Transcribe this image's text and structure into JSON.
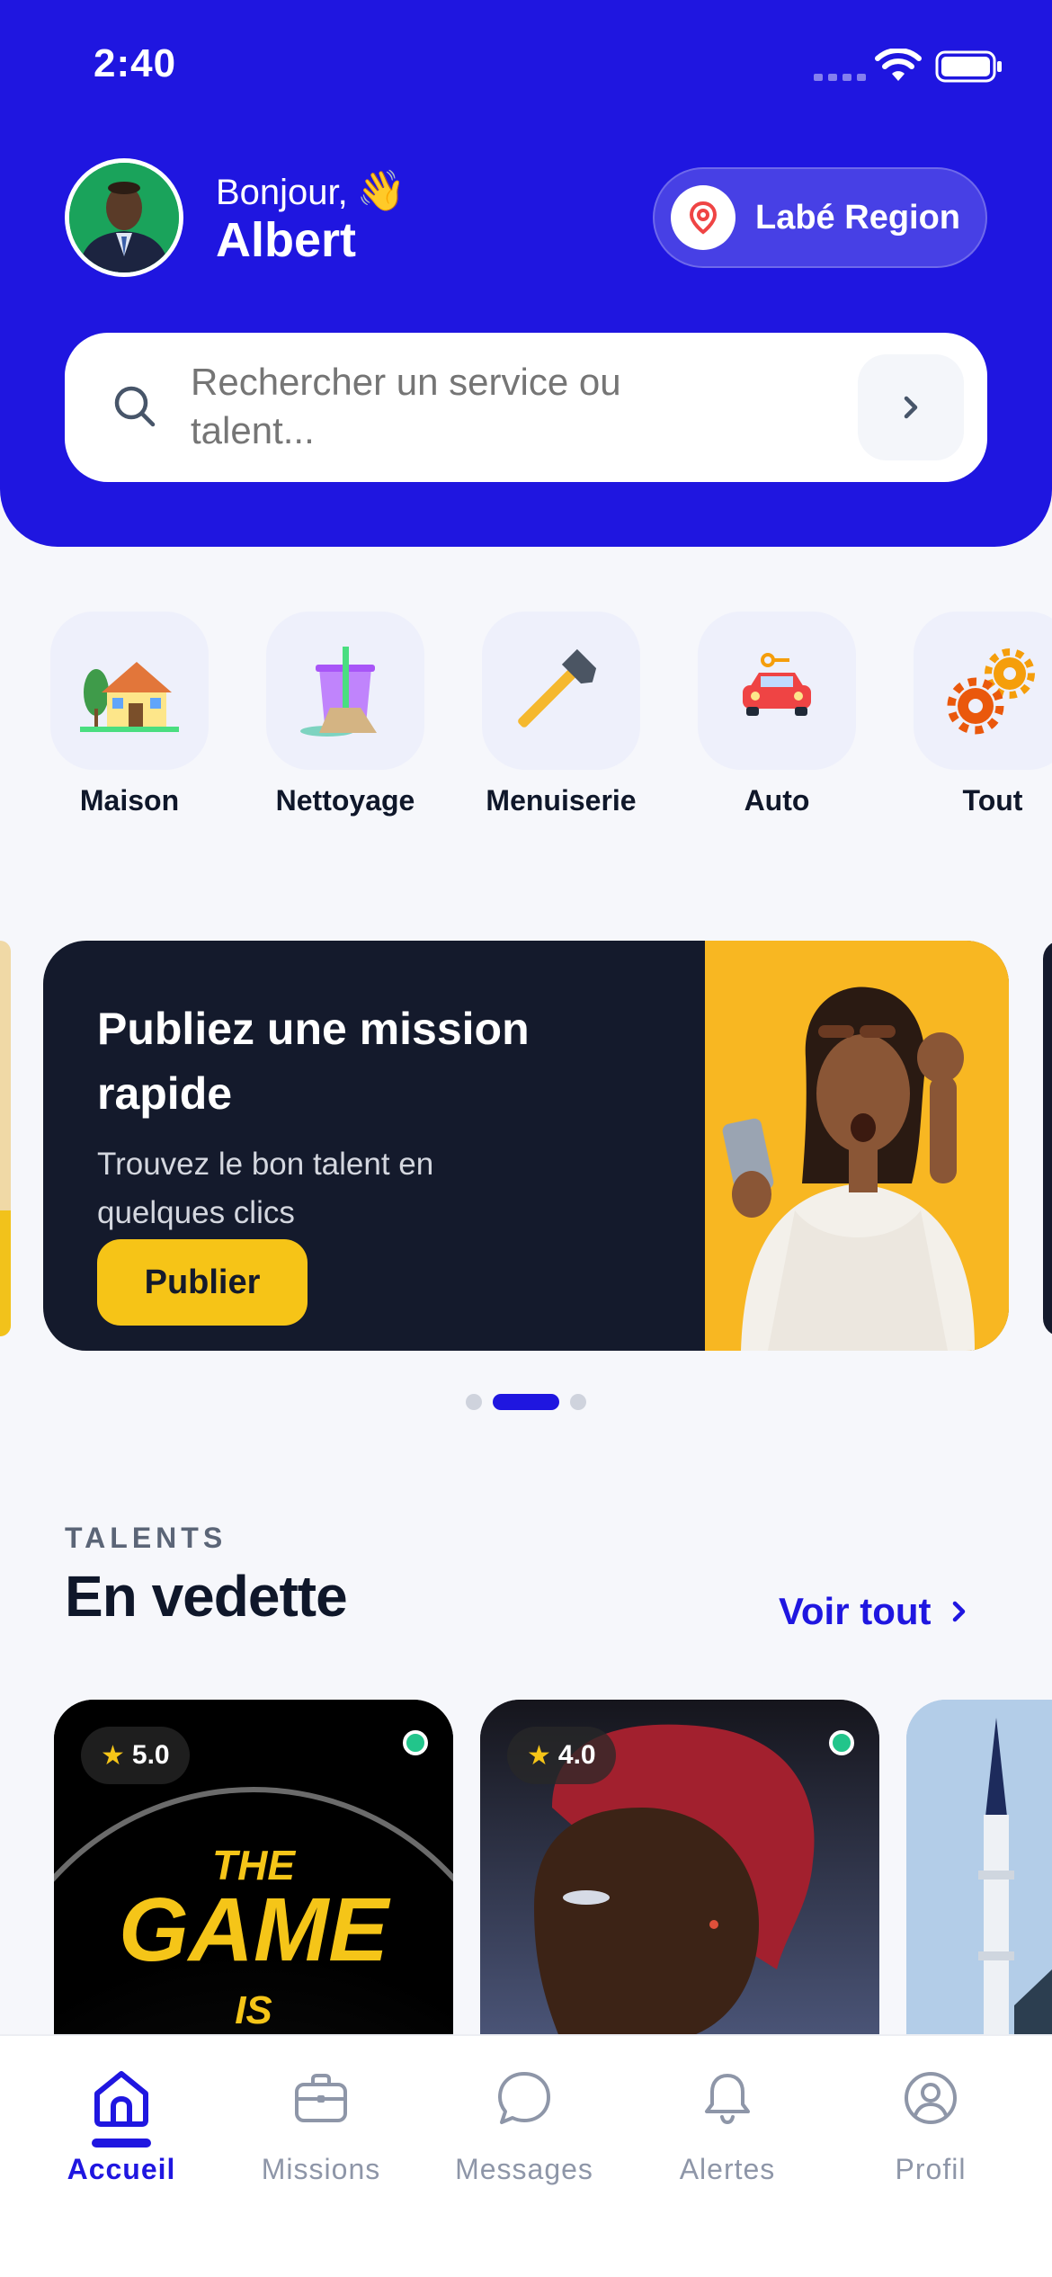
{
  "status_bar": {
    "time": "2:40"
  },
  "header": {
    "greeting": "Bonjour,",
    "greeting_emoji": "👋",
    "user_name": "Albert",
    "region_label": "Labé Region",
    "region_icon": "location-pin-icon"
  },
  "search": {
    "placeholder": "Rechercher un service ou talent...",
    "icon": "search-icon"
  },
  "categories": [
    {
      "label": "Maison",
      "icon": "house-icon"
    },
    {
      "label": "Nettoyage",
      "icon": "cleaning-bucket-icon"
    },
    {
      "label": "Menuiserie",
      "icon": "hammer-icon"
    },
    {
      "label": "Auto",
      "icon": "car-icon"
    },
    {
      "label": "Tout",
      "icon": "gears-icon"
    }
  ],
  "promo": {
    "title": "Publiez une mission rapide",
    "subtitle": "Trouvez le bon talent en quelques clics",
    "button": "Publier",
    "active_slide": 2,
    "slide_count": 3
  },
  "talents": {
    "kicker": "TALENTS",
    "title": "En vedette",
    "see_all": "Voir tout",
    "cards": [
      {
        "rating": "5.0",
        "online": true,
        "image_text": [
          "THE",
          "GAME",
          "IS"
        ]
      },
      {
        "rating": "4.0",
        "online": true
      },
      {
        "rating": null,
        "online": false
      }
    ]
  },
  "nav": {
    "items": [
      {
        "label": "Accueil",
        "icon": "home-icon",
        "active": true
      },
      {
        "label": "Missions",
        "icon": "briefcase-icon",
        "active": false
      },
      {
        "label": "Messages",
        "icon": "chat-bubble-icon",
        "active": false
      },
      {
        "label": "Alertes",
        "icon": "bell-icon",
        "active": false
      },
      {
        "label": "Profil",
        "icon": "user-circle-icon",
        "active": false
      }
    ]
  },
  "colors": {
    "primary": "#1f16e0",
    "banner_dark": "#141a2c",
    "accent_yellow": "#f6c417",
    "online_green": "#22c58b"
  }
}
